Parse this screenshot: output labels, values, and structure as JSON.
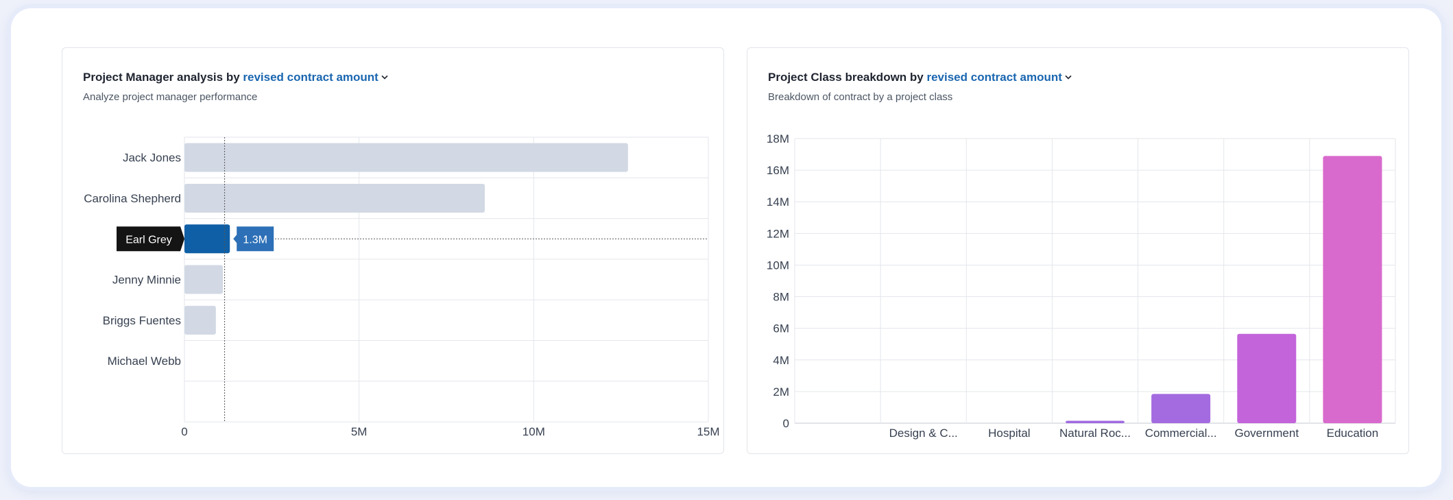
{
  "left_card": {
    "title_prefix": "Project Manager analysis by",
    "metric": "revised contract amount",
    "subtitle": "Analyze project manager performance",
    "tooltip": {
      "category": "Earl Grey",
      "value_label": "1.3M"
    }
  },
  "right_card": {
    "title_prefix": "Project Class breakdown by",
    "metric": "revised contract amount",
    "subtitle": "Breakdown of contract by a project class"
  },
  "colors": {
    "bar_default": "#d2d9e4",
    "bar_active": "#0f5fa6",
    "tooltip_dark": "#141414",
    "link": "#1a66b0",
    "class_bars": [
      "#9d6ee0",
      "#9d6ee0",
      "#a06ae0",
      "#a46be0",
      "#c364db",
      "#d96acd"
    ]
  },
  "chart_data": [
    {
      "type": "bar",
      "orientation": "horizontal",
      "categories": [
        "Jack Jones",
        "Carolina Shepherd",
        "Earl Grey",
        "Jenny Minnie",
        "Briggs Fuentes",
        "Michael Webb"
      ],
      "values": [
        12700000,
        8600000,
        1300000,
        1100000,
        900000,
        0
      ],
      "xlim": [
        0,
        15000000
      ],
      "xticks": [
        0,
        5000000,
        10000000,
        15000000
      ],
      "xtick_labels": [
        "0",
        "5M",
        "10M",
        "15M"
      ],
      "highlighted": "Earl Grey",
      "grid": true
    },
    {
      "type": "bar",
      "orientation": "vertical",
      "categories": [
        "",
        "Design & C...",
        "Hospital",
        "Natural Roc...",
        "Commercial...",
        "Government",
        "Education"
      ],
      "values": [
        0,
        0,
        0,
        150000,
        1850000,
        5650000,
        16900000
      ],
      "ylim": [
        0,
        18000000
      ],
      "yticks": [
        0,
        2000000,
        4000000,
        6000000,
        8000000,
        10000000,
        12000000,
        14000000,
        16000000,
        18000000
      ],
      "ytick_labels": [
        "0",
        "2M",
        "4M",
        "6M",
        "8M",
        "10M",
        "12M",
        "14M",
        "16M",
        "18M"
      ],
      "grid": true
    }
  ]
}
